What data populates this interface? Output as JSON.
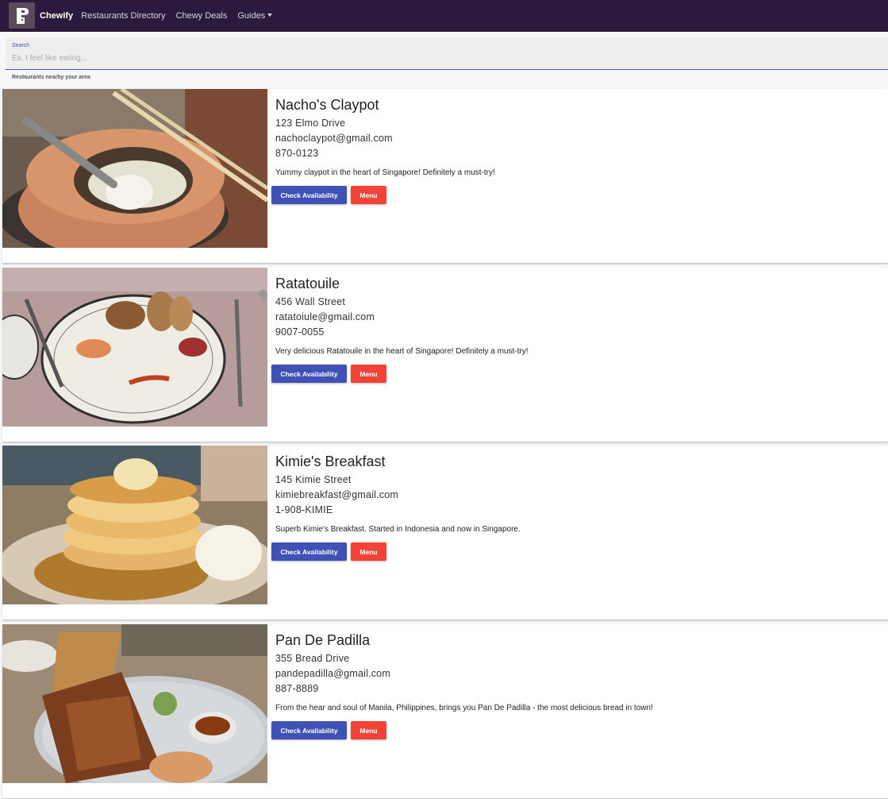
{
  "nav": {
    "brand": "Chewify",
    "links": [
      "Restaurants Directory",
      "Chewy Deals",
      "Guides"
    ]
  },
  "search": {
    "label": "Search",
    "placeholder": "Ex. I feel like eating..."
  },
  "section_label": "Restaurants nearby your area",
  "buttons": {
    "availability": "Check Availability",
    "menu": "Menu"
  },
  "restaurants": [
    {
      "name": "Nacho's Claypot",
      "address": "123 Elmo Drive",
      "email": "nachoclaypot@gmail.com",
      "phone": "870-0123",
      "description": "Yummy claypot in the heart of Singapore! Definitely a must-try!",
      "image": "claypot-food-photo"
    },
    {
      "name": "Ratatouile",
      "address": "456 Wall Street",
      "email": "ratatoiule@gmail.com",
      "phone": "9007-0055",
      "description": "Very delicious Ratatouile in the heart of Singapore! Definitely a must-try!",
      "image": "plated-dish-photo"
    },
    {
      "name": "Kimie's Breakfast",
      "address": "145 Kimie Street",
      "email": "kimiebreakfast@gmail.com",
      "phone": "1-908-KIMIE",
      "description": "Superb Kimie's Breakfast. Started in Indonesia and now in Singapore.",
      "image": "pancakes-photo"
    },
    {
      "name": "Pan De Padilla",
      "address": "355 Bread Drive",
      "email": "pandepadilla@gmail.com",
      "phone": "887-8889",
      "description": "From the hear and soul of Manila, Philippines, brings you Pan De Padilla - the most delicious bread in town!",
      "image": "fried-chicken-waffle-photo"
    }
  ]
}
